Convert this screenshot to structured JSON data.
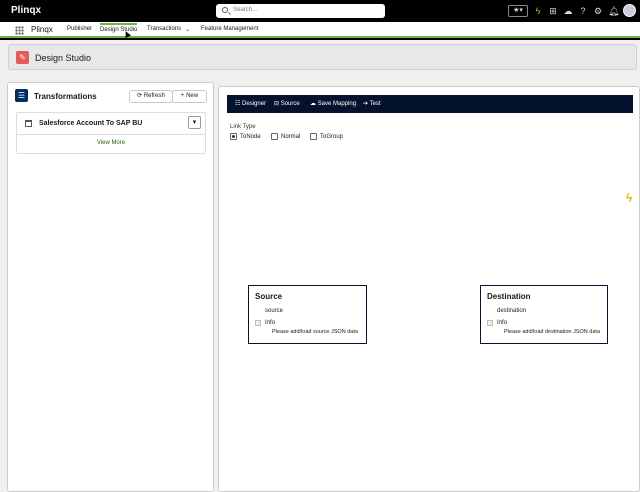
{
  "app": {
    "brand": "Plinqx",
    "name": "Plinqx"
  },
  "search": {
    "placeholder": "Search..."
  },
  "nav": {
    "items": [
      "Publisher",
      "Design Studio",
      "Transactions",
      "Feature Management"
    ]
  },
  "header": {
    "title": "Design Studio"
  },
  "left_panel": {
    "title": "Transformations",
    "refresh_label": "Refresh",
    "new_label": "New",
    "card_title": "Salesforce Account To SAP BU",
    "view_more": "View More"
  },
  "toolbar": {
    "designer": "Designer",
    "source": "Source",
    "save_mapping": "Save Mapping",
    "test": "Test"
  },
  "link_type": {
    "label": "Link Type",
    "options": [
      "ToNode",
      "Normal",
      "ToGroup"
    ],
    "selected": "ToNode"
  },
  "source_node": {
    "title": "Source",
    "sub": "source",
    "info": "Info",
    "message": "Please add/load source JSON data"
  },
  "dest_node": {
    "title": "Destination",
    "sub": "destination",
    "info": "Info",
    "message": "Please add/load destination JSON data"
  },
  "colors": {
    "nav_accent": "#6fb43f",
    "toolbar_bg": "#05122e",
    "header_icon": "#e35b5b"
  }
}
